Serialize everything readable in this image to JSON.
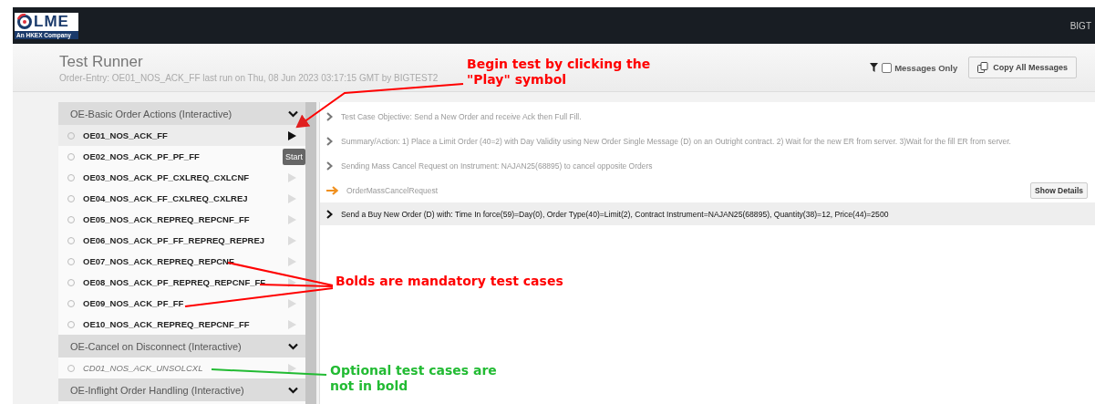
{
  "header": {
    "logo": {
      "wordmark": "LME",
      "tagline": "An HKEX Company"
    },
    "user": "BIGT"
  },
  "page": {
    "title": "Test Runner",
    "subtitle": "Order-Entry: OE01_NOS_ACK_FF last run on Thu, 08 Jun 2023 03:17:15 GMT by BIGTEST2"
  },
  "toolbar": {
    "messages_only": {
      "label": "Messages Only",
      "checked": false
    },
    "copy_button": "Copy All Messages"
  },
  "groups": [
    {
      "title": "OE-Basic Order Actions (Interactive)",
      "expanded": true,
      "items": [
        {
          "name": "OE01_NOS_ACK_FF",
          "mandatory": true,
          "selected": true,
          "tooltip": "Start"
        },
        {
          "name": "OE02_NOS_ACK_PF_PF_FF",
          "mandatory": true,
          "selected": false
        },
        {
          "name": "OE03_NOS_ACK_PF_CXLREQ_CXLCNF",
          "mandatory": true,
          "selected": false
        },
        {
          "name": "OE04_NOS_ACK_FF_CXLREQ_CXLREJ",
          "mandatory": true,
          "selected": false
        },
        {
          "name": "OE05_NOS_ACK_REPREQ_REPCNF_FF",
          "mandatory": true,
          "selected": false
        },
        {
          "name": "OE06_NOS_ACK_PF_FF_REPREQ_REPREJ",
          "mandatory": true,
          "selected": false
        },
        {
          "name": "OE07_NOS_ACK_REPREQ_REPCNF",
          "mandatory": true,
          "selected": false
        },
        {
          "name": "OE08_NOS_ACK_PF_REPREQ_REPCNF_FF",
          "mandatory": true,
          "selected": false
        },
        {
          "name": "OE09_NOS_ACK_PF_FF",
          "mandatory": true,
          "selected": false
        },
        {
          "name": "OE10_NOS_ACK_REPREQ_REPCNF_FF",
          "mandatory": true,
          "selected": false
        }
      ]
    },
    {
      "title": "OE-Cancel on Disconnect (Interactive)",
      "expanded": true,
      "items": [
        {
          "name": "CD01_NOS_ACK_UNSOLCXL",
          "mandatory": false,
          "selected": false
        }
      ]
    },
    {
      "title": "OE-Inflight Order Handling (Interactive)",
      "expanded": true
    }
  ],
  "log": [
    {
      "kind": "info",
      "text": "Test Case Objective: Send a New Order and receive Ack then Full Fill."
    },
    {
      "kind": "info",
      "text": "Summary/Action: 1) Place a Limit Order (40=2) with Day Validity using New Order Single Message (D) on an Outright contract. 2) Wait for the new ER from server. 3)Wait for the fill ER from server."
    },
    {
      "kind": "info",
      "text": "Sending Mass Cancel Request on Instrument: NAJAN25(68895) to cancel opposite Orders"
    },
    {
      "kind": "message",
      "text": "OrderMassCancelRequest",
      "button": "Show Details"
    },
    {
      "kind": "action",
      "text": "Send a Buy New Order (D) with: Time In force(59)=Day(0), Order Type(40)=Limit(2), Contract Instrument=NAJAN25(68895), Quantity(38)=12, Price(44)=2500"
    }
  ],
  "annotations": [
    {
      "kind": "play",
      "lines": [
        "Begin test by clicking the",
        "\"Play\" symbol"
      ],
      "color": "#ff0000"
    },
    {
      "kind": "bold",
      "lines": [
        "Bolds are mandatory test cases"
      ],
      "color": "#ff0000"
    },
    {
      "kind": "optional",
      "lines": [
        "Optional test cases are",
        "not in bold"
      ],
      "color": "#22bb33"
    }
  ]
}
